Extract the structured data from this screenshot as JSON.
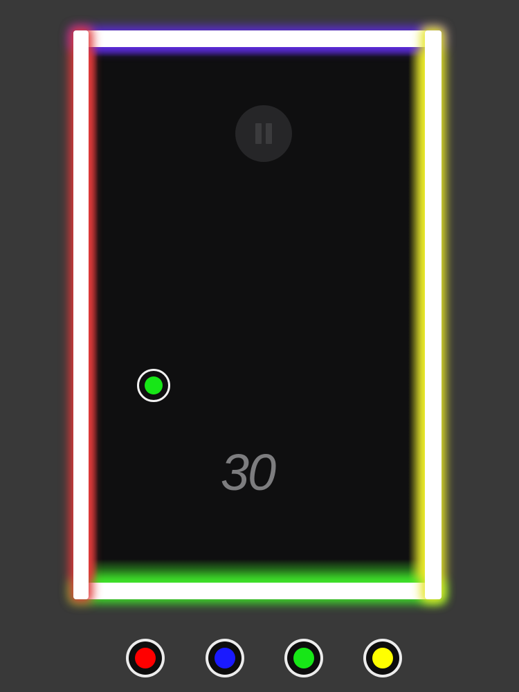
{
  "game": {
    "score": "30",
    "pause_icon": "pause-icon"
  },
  "player": {
    "color_name": "green",
    "color": "#17e617"
  },
  "walls": {
    "top": "#5a2bd6",
    "left": "#e03a3a",
    "right": "#e6e62a",
    "bottom": "#3fe02a"
  },
  "color_buttons": [
    {
      "name": "red",
      "color": "#ff0000"
    },
    {
      "name": "blue",
      "color": "#1a1aff"
    },
    {
      "name": "green",
      "color": "#17e617"
    },
    {
      "name": "yellow",
      "color": "#ffff00"
    }
  ]
}
